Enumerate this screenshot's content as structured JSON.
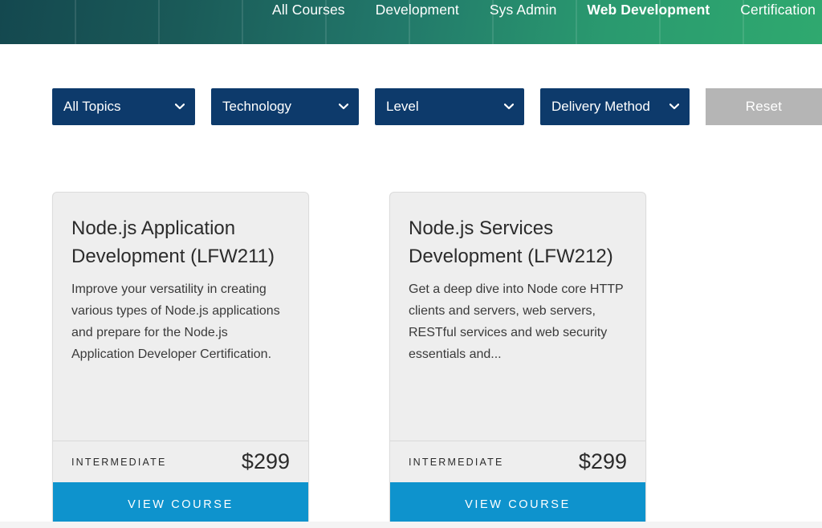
{
  "nav": {
    "items": [
      {
        "label": "All Courses",
        "active": false
      },
      {
        "label": "Development",
        "active": false
      },
      {
        "label": "Sys Admin",
        "active": false
      },
      {
        "label": "Web Development",
        "active": true
      },
      {
        "label": "Certification",
        "active": false
      }
    ],
    "gradient_from": "#14484f",
    "gradient_to": "#2fa96f"
  },
  "filters": {
    "topic": {
      "value": "All Topics",
      "icon": "chevron-down-icon"
    },
    "technology": {
      "value": "Technology",
      "icon": "chevron-down-icon"
    },
    "level": {
      "value": "Level",
      "icon": "chevron-down-icon"
    },
    "delivery": {
      "value": "Delivery Method",
      "icon": "chevron-down-icon"
    },
    "reset_label": "Reset",
    "select_bg": "#0d3a6b",
    "reset_bg": "#b5b5b5"
  },
  "cards": [
    {
      "title": "Node.js Application Development (LFW211)",
      "description": "Improve your versatility in creating various types of Node.js applications and prepare for the Node.js Application Developer Certification.",
      "level": "INTERMEDIATE",
      "price": "$299",
      "cta": "VIEW COURSE"
    },
    {
      "title": "Node.js Services Development (LFW212)",
      "description": "Get a deep dive into Node core HTTP clients and servers, web servers, RESTful services and web security essentials and...",
      "level": "INTERMEDIATE",
      "price": "$299",
      "cta": "VIEW COURSE"
    }
  ],
  "theme": {
    "cta_color": "#0e93cd",
    "card_bg": "#eeeeee"
  }
}
